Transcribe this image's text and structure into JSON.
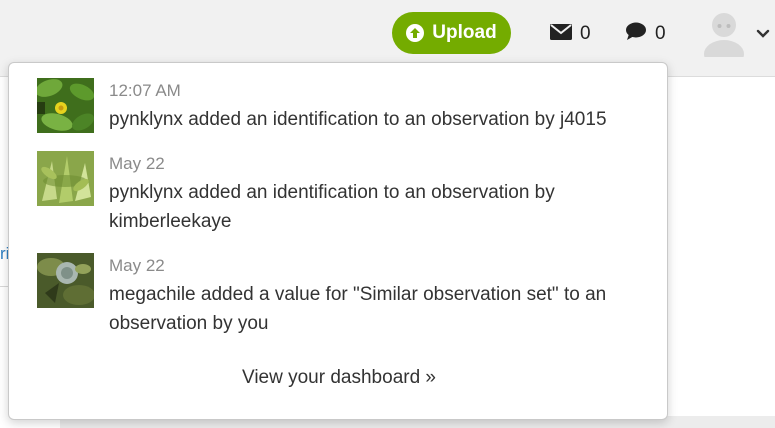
{
  "header": {
    "upload_label": "Upload",
    "messages_count": "0",
    "comments_count": "0",
    "accent_color": "#74ac00"
  },
  "background": {
    "fragment_text": "ri"
  },
  "notifications": [
    {
      "time": "12:07 AM",
      "text": "pynklynx added an identification to an observation by j4015",
      "thumb": "green-leaves-yellow-flower"
    },
    {
      "time": "May 22",
      "text": "pynklynx added an identification to an observation by kimberleekaye",
      "thumb": "pale-green-plant"
    },
    {
      "time": "May 22",
      "text": "megachile added a value for \"Similar observation set\" to an observation by you",
      "thumb": "insect-on-leaves"
    }
  ],
  "dashboard_link": "View your dashboard »"
}
